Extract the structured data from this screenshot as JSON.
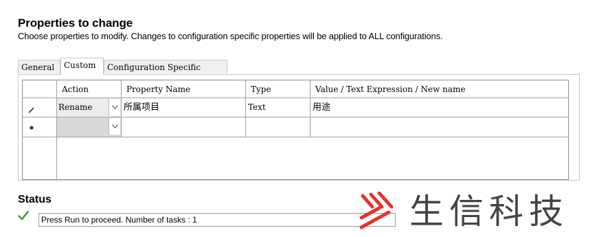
{
  "header": {
    "title": "Properties to change",
    "subtitle": "Choose properties to modify.  Changes to configuration specific properties will be applied to ALL configurations."
  },
  "tabs": [
    {
      "label": "General"
    },
    {
      "label": "Custom",
      "active": true
    },
    {
      "label": "Configuration Specific"
    }
  ],
  "grid": {
    "columns": [
      "Action",
      "Property Name",
      "Type",
      "Value / Text Expression / New name"
    ],
    "rows": [
      {
        "action": "Rename",
        "property_name": "所属项目",
        "type": "Text",
        "value": "用途"
      },
      {
        "action": "",
        "property_name": "",
        "type": "",
        "value": ""
      }
    ]
  },
  "status": {
    "title": "Status",
    "message": "Press Run to proceed. Number of tasks : 1"
  },
  "watermark": {
    "text": "生信科技",
    "brand_color": "#e3342f"
  }
}
